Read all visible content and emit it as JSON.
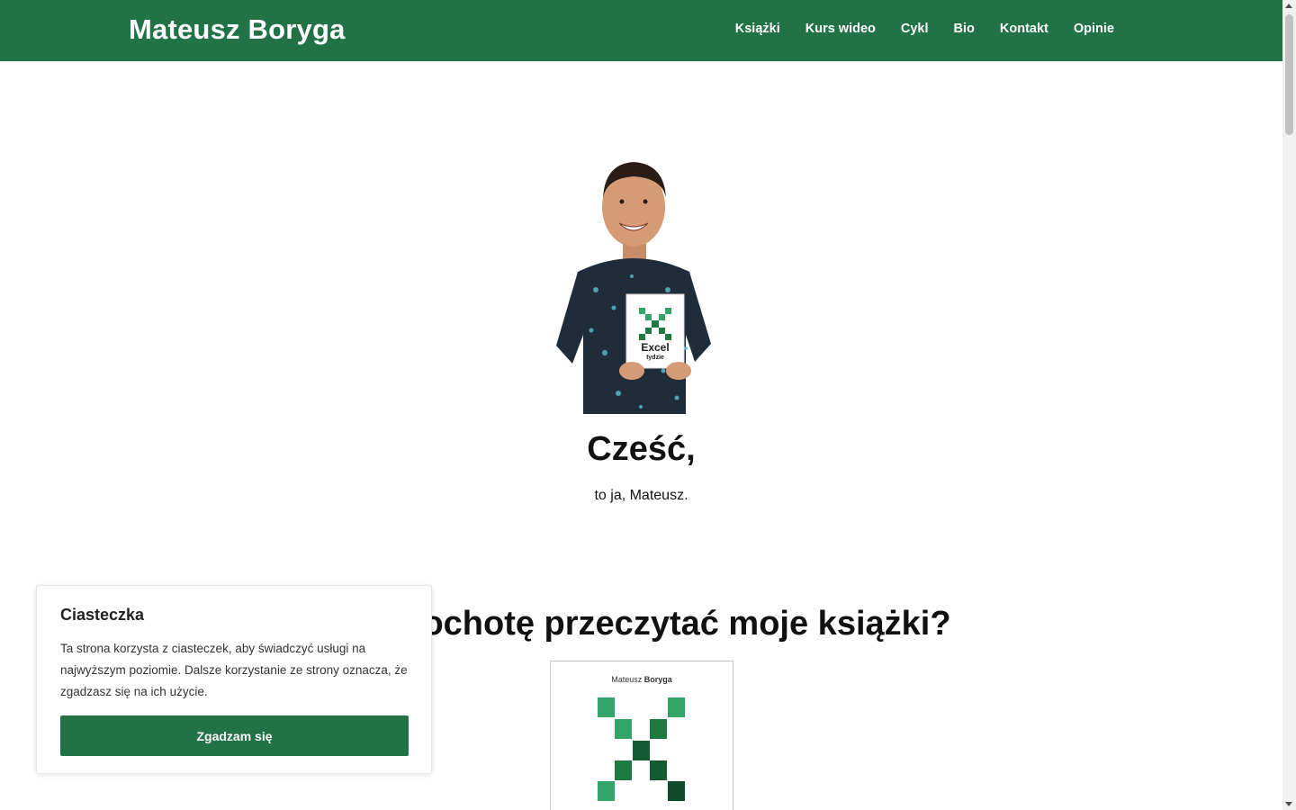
{
  "header": {
    "brand": "Mateusz Boryga",
    "nav": [
      "Książki",
      "Kurs wideo",
      "Cykl",
      "Bio",
      "Kontakt",
      "Opinie"
    ]
  },
  "hero": {
    "title": "Cześć,",
    "subtitle": "to ja, Mateusz.",
    "book_in_hand_title": "Excel",
    "book_in_hand_subtitle": "tydzie"
  },
  "books_section": {
    "title": "ochotę przeczytać moje książki?",
    "cover_author_first": "Mateusz",
    "cover_author_last": "Boryga"
  },
  "cookie_banner": {
    "title": "Ciasteczka",
    "text": "Ta strona korzysta z ciasteczek, aby świadczyć usługi na najwyższym poziomie. Dalsze korzystanie ze strony oznacza, że zgadzasz się na ich użycie.",
    "button": "Zgadzam się"
  },
  "colors": {
    "brand_green": "#217346",
    "light_green": "#33a467",
    "mid_green": "#1f7a42",
    "dark_green": "#0f4a2a"
  }
}
